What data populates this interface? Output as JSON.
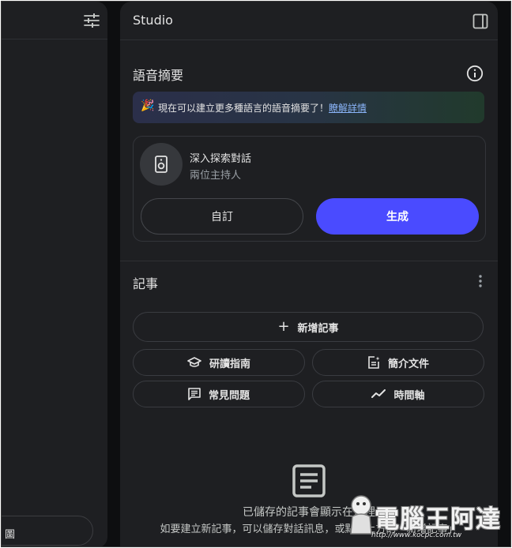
{
  "studio": {
    "title": "Studio"
  },
  "audio_overview": {
    "heading": "語音摘要",
    "banner_text": "現在可以建立更多種語言的語音摘要了！",
    "banner_link": "瞭解詳情",
    "card_title": "深入探索對話",
    "card_subtitle": "兩位主持人",
    "customize_label": "自訂",
    "generate_label": "生成"
  },
  "notes": {
    "heading": "記事",
    "add_note_label": "新增記事",
    "buttons": [
      {
        "label": "研讀指南",
        "icon": "school-icon"
      },
      {
        "label": "簡介文件",
        "icon": "briefing-doc-icon"
      },
      {
        "label": "常見問題",
        "icon": "faq-icon"
      },
      {
        "label": "時間軸",
        "icon": "timeline-icon"
      }
    ],
    "empty_title": "已儲存的記事會顯示在這裡",
    "empty_hint": "如要建立新記事，可以儲存對話訊息，或點選上方的「新增記事」"
  },
  "left_panel": {
    "input_glyph": "圖"
  },
  "watermark": {
    "text": "電腦王阿達",
    "url": "http://www.kocpc.com.tw"
  },
  "colors": {
    "background": "#0d0e10",
    "panel": "#1e1f22",
    "accent": "#4a4bff",
    "link": "#8ab4f8"
  }
}
